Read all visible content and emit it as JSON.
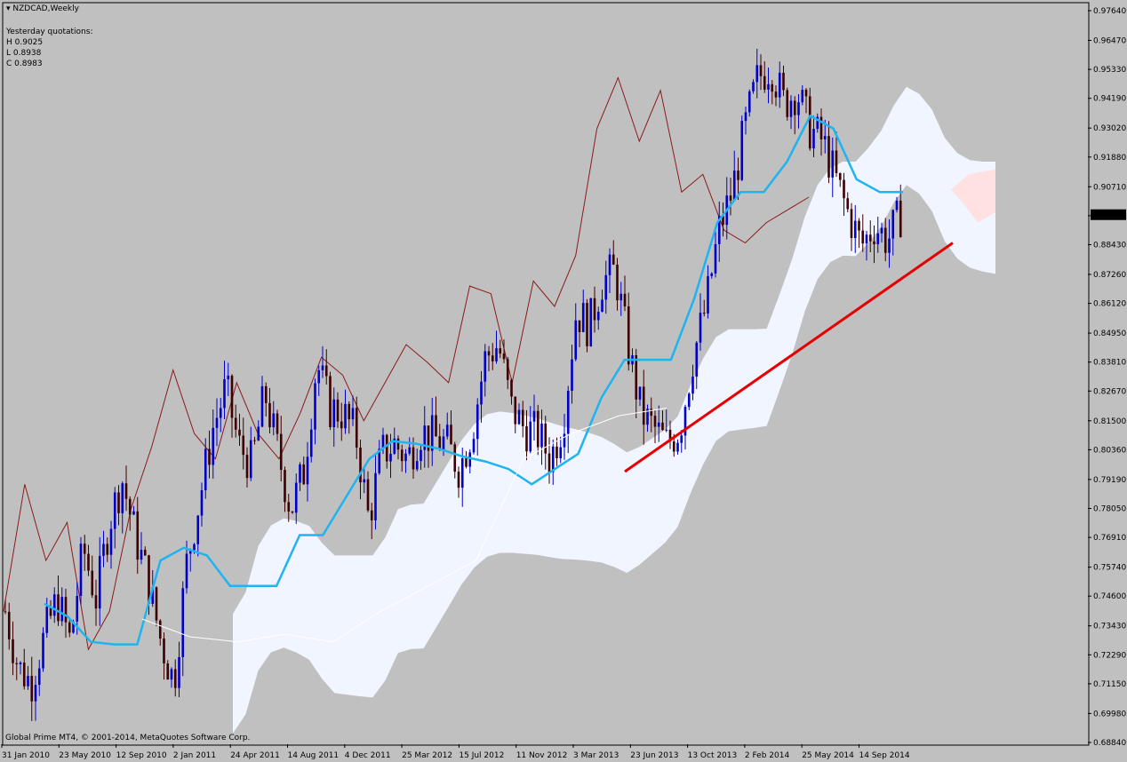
{
  "header": {
    "title": "NZDCAD,Weekly",
    "quotes_label": "Yesterday quotations:",
    "high": "H 0.9025",
    "low": "L 0.8938",
    "close": "C 0.8983"
  },
  "footer": {
    "copyright": "Global Prime MT4, © 2001-2014, MetaQuotes Software Corp."
  },
  "colors": {
    "background": "#c0c0c0",
    "bull_candle": "#0000c8",
    "bear_candle": "#3c0000",
    "kijun": "#1eb4f0",
    "tenkan": "#8b1a1a",
    "chikou": "#ffffff",
    "cloud_bull": "#f0f5ff",
    "cloud_bear": "#ffe1e1",
    "trendline": "#e60000"
  },
  "chart_data": {
    "type": "candlestick",
    "symbol": "NZDCAD",
    "timeframe": "Weekly",
    "ylim": [
      0.6884,
      0.9764
    ],
    "y_ticks": [
      "0.97640",
      "0.96470",
      "0.95330",
      "0.94190",
      "0.93020",
      "0.91880",
      "0.90710",
      "0.89570",
      "0.88430",
      "0.87260",
      "0.86120",
      "0.84950",
      "0.83810",
      "0.82670",
      "0.81500",
      "0.80360",
      "0.79190",
      "0.78050",
      "0.76910",
      "0.75740",
      "0.74600",
      "0.73430",
      "0.72290",
      "0.71150",
      "0.69980",
      "0.68840"
    ],
    "x_ticks": [
      "31 Jan 2010",
      "23 May 2010",
      "12 Sep 2010",
      "2 Jan 2011",
      "24 Apr 2011",
      "14 Aug 2011",
      "4 Dec 2011",
      "25 Mar 2012",
      "15 Jul 2012",
      "11 Nov 2012",
      "3 Mar 2013",
      "23 Jun 2013",
      "13 Oct 2013",
      "2 Feb 2014",
      "25 May 2014",
      "14 Sep 2014"
    ],
    "current_price": "0.89611",
    "close_path": [
      0.74,
      0.718,
      0.712,
      0.73,
      0.745,
      0.728,
      0.765,
      0.745,
      0.775,
      0.792,
      0.77,
      0.752,
      0.728,
      0.712,
      0.76,
      0.785,
      0.812,
      0.828,
      0.805,
      0.798,
      0.826,
      0.803,
      0.78,
      0.795,
      0.838,
      0.82,
      0.818,
      0.81,
      0.776,
      0.802,
      0.806,
      0.8,
      0.811,
      0.808,
      0.806,
      0.796,
      0.812,
      0.84,
      0.845,
      0.82,
      0.812,
      0.81,
      0.8,
      0.815,
      0.858,
      0.852,
      0.87,
      0.874,
      0.844,
      0.818,
      0.812,
      0.806,
      0.812,
      0.84,
      0.86,
      0.89,
      0.905,
      0.93,
      0.95,
      0.955,
      0.94,
      0.945,
      0.93,
      0.925,
      0.91,
      0.896,
      0.884,
      0.892,
      0.886,
      0.896
    ],
    "series": [
      {
        "name": "Kijun-sen",
        "values": [
          0.743,
          0.738,
          0.728,
          0.727,
          0.727,
          0.76,
          0.765,
          0.762,
          0.75,
          0.75,
          0.75,
          0.77,
          0.77,
          0.785,
          0.8,
          0.807,
          0.806,
          0.804,
          0.801,
          0.799,
          0.796,
          0.79,
          0.796,
          0.802,
          0.824,
          0.839,
          0.839,
          0.839,
          0.863,
          0.893,
          0.905,
          0.905,
          0.917,
          0.935,
          0.93,
          0.91,
          0.905,
          0.905
        ]
      },
      {
        "name": "Tenkan-sen",
        "values": [
          0.74,
          0.79,
          0.76,
          0.775,
          0.725,
          0.74,
          0.78,
          0.805,
          0.835,
          0.81,
          0.8,
          0.83,
          0.81,
          0.8,
          0.818,
          0.84,
          0.833,
          0.815,
          0.83,
          0.845,
          0.838,
          0.83,
          0.868,
          0.865,
          0.83,
          0.87,
          0.86,
          0.88,
          0.93,
          0.95,
          0.925,
          0.945,
          0.905,
          0.912,
          0.89,
          0.885,
          0.893,
          0.898,
          0.903
        ]
      },
      {
        "name": "Chikou Span",
        "values": [
          0.737,
          0.73,
          0.728,
          0.731,
          0.728,
          0.74,
          0.75,
          0.76,
          0.8,
          0.81,
          0.817,
          0.82
        ]
      },
      {
        "name": "Trendline",
        "values": [
          0.795,
          0.885
        ]
      }
    ]
  }
}
